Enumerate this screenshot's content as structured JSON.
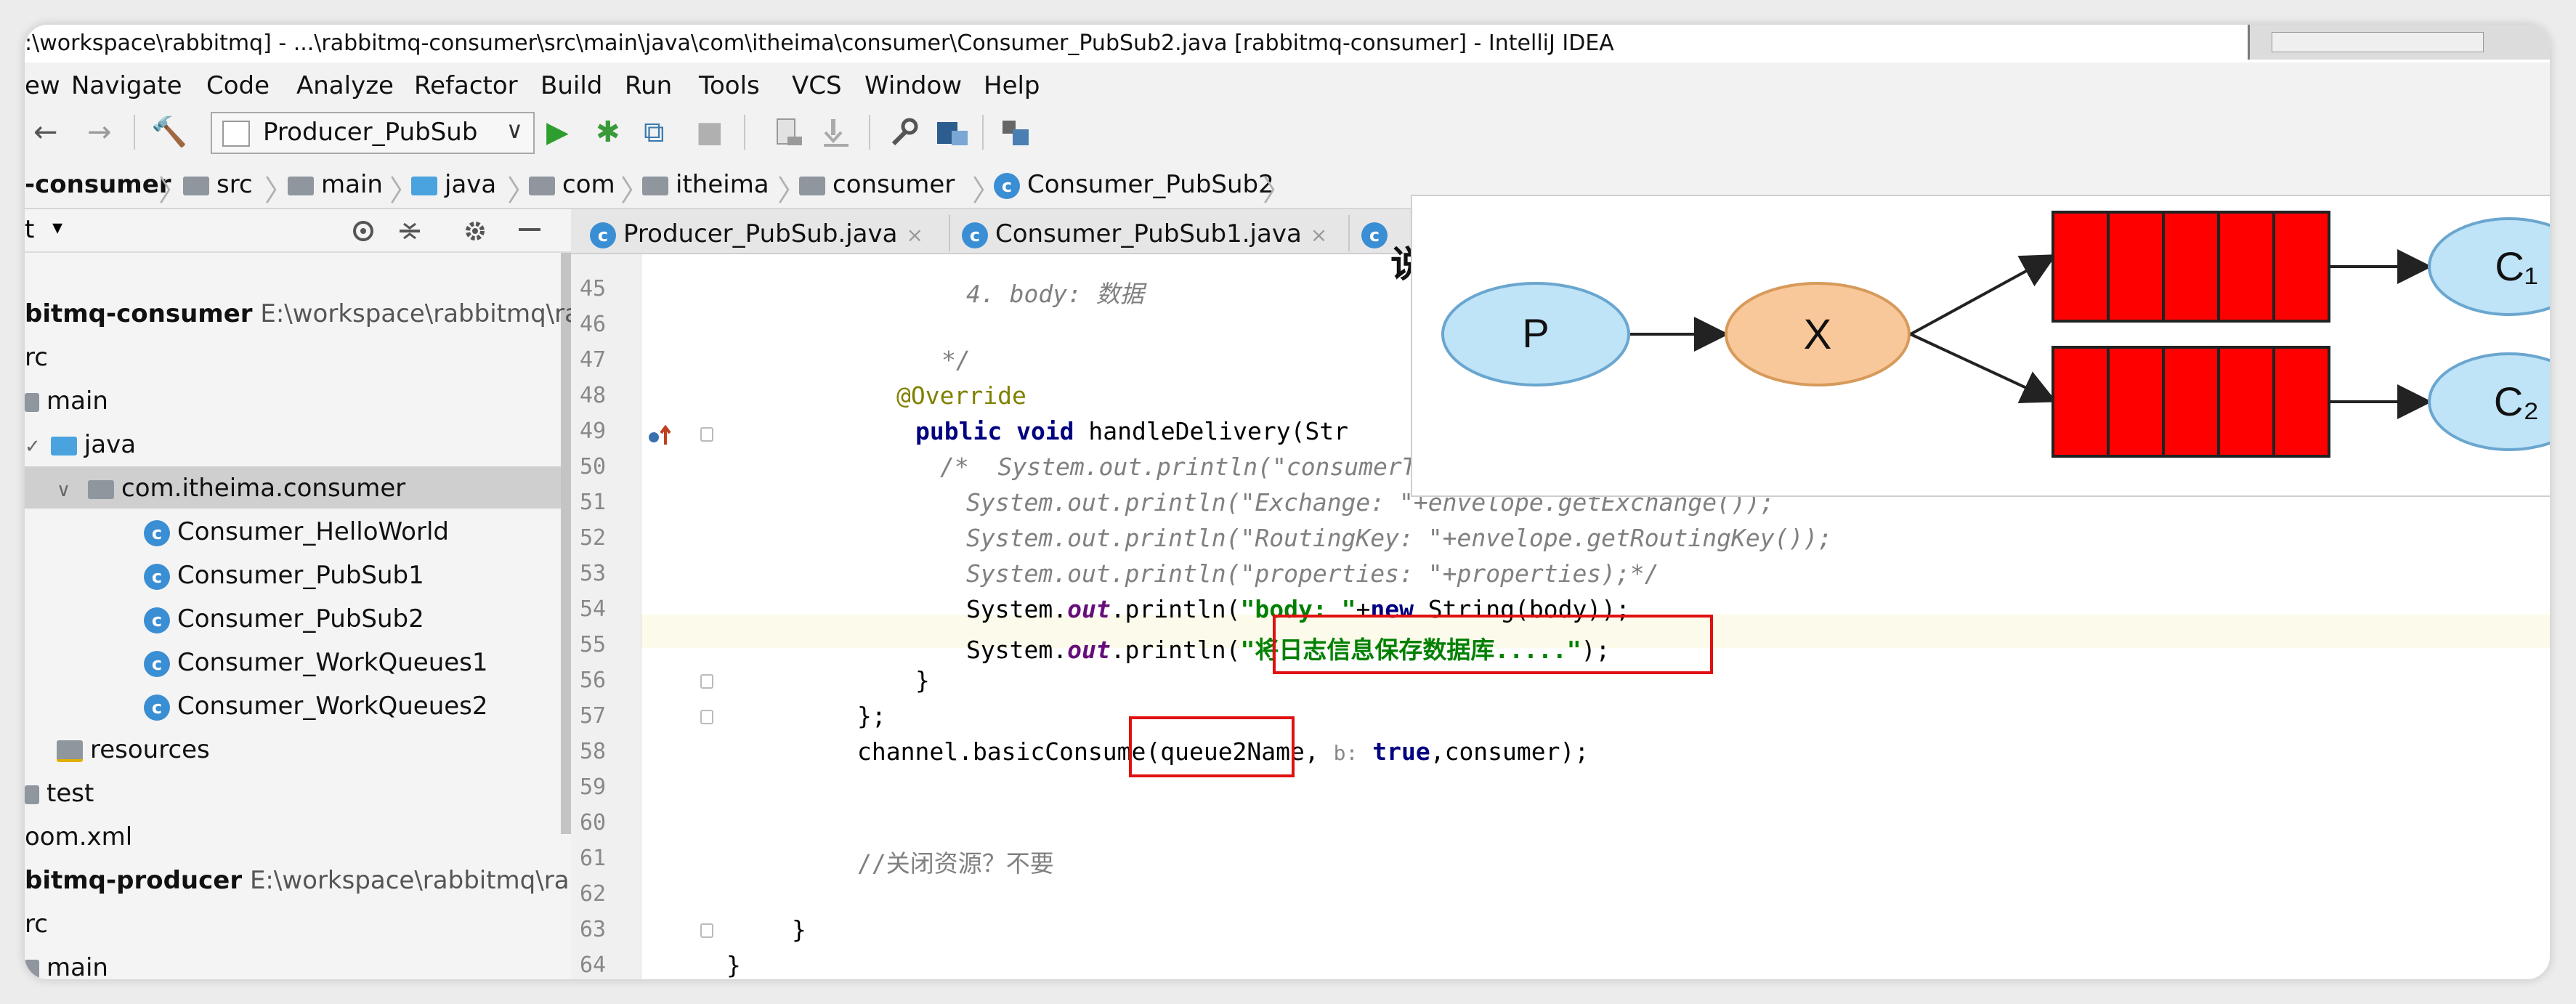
{
  "window": {
    "title": ":\\workspace\\rabbitmq] - ...\\rabbitmq-consumer\\src\\main\\java\\com\\itheima\\consumer\\Consumer_PubSub2.java [rabbitmq-consumer] - IntelliJ IDEA"
  },
  "menu": [
    "ew",
    "Navigate",
    "Code",
    "Analyze",
    "Refactor",
    "Build",
    "Run",
    "Tools",
    "VCS",
    "Window",
    "Help"
  ],
  "toolbar": {
    "back": "←",
    "forward": "→",
    "build": "🔨",
    "run_config": "Producer_PubSub",
    "run": "▶",
    "debug": "✱",
    "coverage": "⧉",
    "stop": "■",
    "dropdown": "∨"
  },
  "breadcrumbs": [
    "-consumer",
    "src",
    "main",
    "java",
    "com",
    "itheima",
    "consumer",
    "Consumer_PubSub2"
  ],
  "project_panel": {
    "header_label": "t",
    "items": [
      {
        "label": "bitmq-consumer",
        "path": "E:\\workspace\\rabbitmq\\rab"
      },
      {
        "label": "rc"
      },
      {
        "label": "main"
      },
      {
        "label": "java"
      },
      {
        "label": "com.itheima.consumer"
      },
      {
        "label": "Consumer_HelloWorld"
      },
      {
        "label": "Consumer_PubSub1"
      },
      {
        "label": "Consumer_PubSub2"
      },
      {
        "label": "Consumer_WorkQueues1"
      },
      {
        "label": "Consumer_WorkQueues2"
      },
      {
        "label": "resources"
      },
      {
        "label": "test"
      },
      {
        "label": "oom.xml"
      },
      {
        "label": "bitmq-producer",
        "path": "E:\\workspace\\rabbitmq\\rabb"
      },
      {
        "label": "rc"
      },
      {
        "label": "main"
      }
    ]
  },
  "tabs": [
    {
      "label": "Producer_PubSub.java",
      "close": "×"
    },
    {
      "label": "Consumer_PubSub1.java",
      "close": "×"
    }
  ],
  "editor": {
    "line_numbers": [
      "45",
      "46",
      "47",
      "48",
      "49",
      "50",
      "51",
      "52",
      "53",
      "54",
      "55",
      "56",
      "57",
      "58",
      "59",
      "60",
      "61",
      "62",
      "63",
      "64"
    ],
    "lines": {
      "l45": "4. body: 数据",
      "l47": "*/",
      "l48": "@Override",
      "l49_kw": "public void",
      "l49_rest": " handleDelivery(Str",
      "l50": "/*  System.out.println(\"consumerTag: \"+consumerTag);",
      "l51": "System.out.println(\"Exchange: \"+envelope.getExchange());",
      "l52": "System.out.println(\"RoutingKey: \"+envelope.getRoutingKey());",
      "l53": "System.out.println(\"properties: \"+properties);*/",
      "l54_a": "System.",
      "l54_out": "out",
      "l54_b": ".println(",
      "l54_str": "\"body: \"",
      "l54_c": "+",
      "l54_new": "new",
      "l54_d": " String(body));",
      "l55_a": "System.",
      "l55_out": "out",
      "l55_b": ".println(",
      "l55_str": "\"将日志信息保存数据库.....\"",
      "l55_c": ");",
      "l56": "}",
      "l57": "};",
      "l58_a": "channel.basicConsume(queue2Name, ",
      "l58_hint": "b:",
      "l58_kw": " true",
      "l58_b": ",consumer);",
      "l61": "//关闭资源？不要",
      "l63": "}",
      "l64": "}"
    }
  },
  "diagram": {
    "title": "说明",
    "producer": "P",
    "exchange": "X",
    "consumer1": "C₁",
    "consumer2": "C₂",
    "queue_color": "#ff0000",
    "node_p_color": "#bfe3f7",
    "node_x_color": "#f9c89a"
  }
}
